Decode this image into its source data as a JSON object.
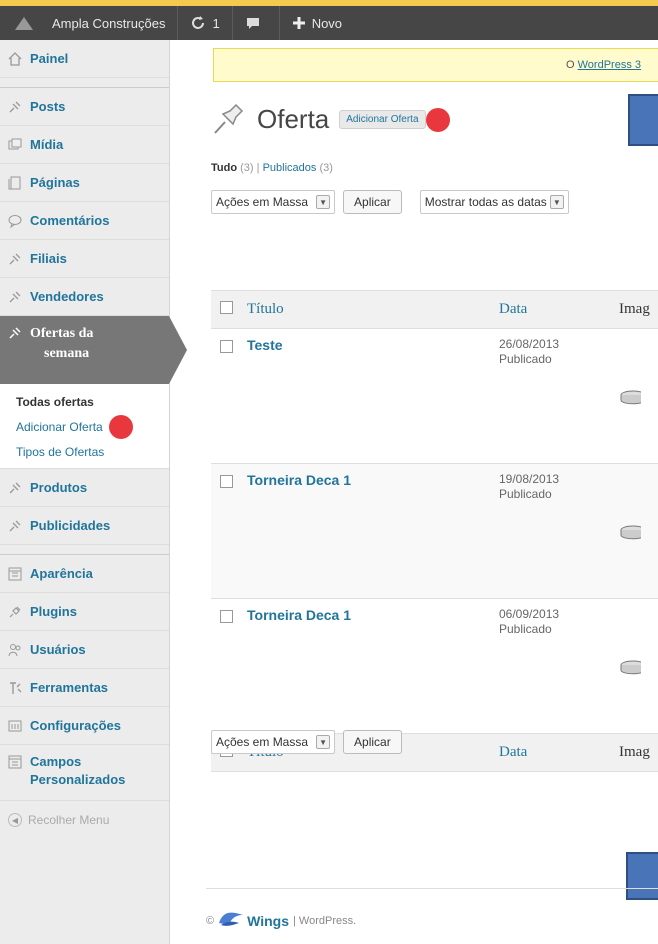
{
  "adminbar": {
    "site_name": "Ampla Construções",
    "updates_count": "1",
    "new_label": "Novo"
  },
  "sidebar": {
    "items": [
      {
        "label": "Painel",
        "icon": "home-icon"
      },
      {
        "label": "Posts",
        "icon": "pin-icon"
      },
      {
        "label": "Mídia",
        "icon": "media-icon"
      },
      {
        "label": "Páginas",
        "icon": "page-icon"
      },
      {
        "label": "Comentários",
        "icon": "comment-icon"
      },
      {
        "label": "Filiais",
        "icon": "pin-icon"
      },
      {
        "label": "Vendedores",
        "icon": "pin-icon"
      }
    ],
    "active": {
      "line1": "Ofertas da",
      "line2": "semana"
    },
    "submenu": {
      "all": "Todas ofertas",
      "add": "Adicionar Oferta",
      "types": "Tipos de Ofertas"
    },
    "items2": [
      {
        "label": "Produtos"
      },
      {
        "label": "Publicidades"
      }
    ],
    "items3": [
      {
        "label": "Aparência"
      },
      {
        "label": "Plugins"
      },
      {
        "label": "Usuários"
      },
      {
        "label": "Ferramentas"
      },
      {
        "label": "Configurações"
      },
      {
        "label": "Campos Personalizados"
      }
    ],
    "collapse": "Recolher Menu"
  },
  "notice": {
    "prefix": "O ",
    "link": "WordPress 3"
  },
  "page": {
    "title": "Oferta",
    "add_new": "Adicionar Oferta"
  },
  "filters": {
    "all": "Tudo",
    "all_count": "(3)",
    "sep": "|",
    "published": "Publicados",
    "published_count": "(3)"
  },
  "tablenav": {
    "bulk": "Ações em Massa",
    "apply": "Aplicar",
    "dates": "Mostrar todas as datas"
  },
  "table": {
    "columns": [
      "Título",
      "Data",
      "Imag"
    ],
    "rows": [
      {
        "title": "Teste",
        "date": "26/08/2013",
        "status": "Publicado"
      },
      {
        "title": "Torneira Deca 1",
        "date": "19/08/2013",
        "status": "Publicado"
      },
      {
        "title": "Torneira Deca 1",
        "date": "06/09/2013",
        "status": "Publicado"
      }
    ]
  },
  "footer": {
    "prefix": "©",
    "brand": "Wings",
    "suffix": "| WordPress."
  },
  "colors": {
    "adminbar": "#464646",
    "accent_stripe": "#f3c94f",
    "link": "#21759b",
    "active_menu": "#777777",
    "marker_red": "#e8383d",
    "blue_box": "#4a74b8"
  }
}
